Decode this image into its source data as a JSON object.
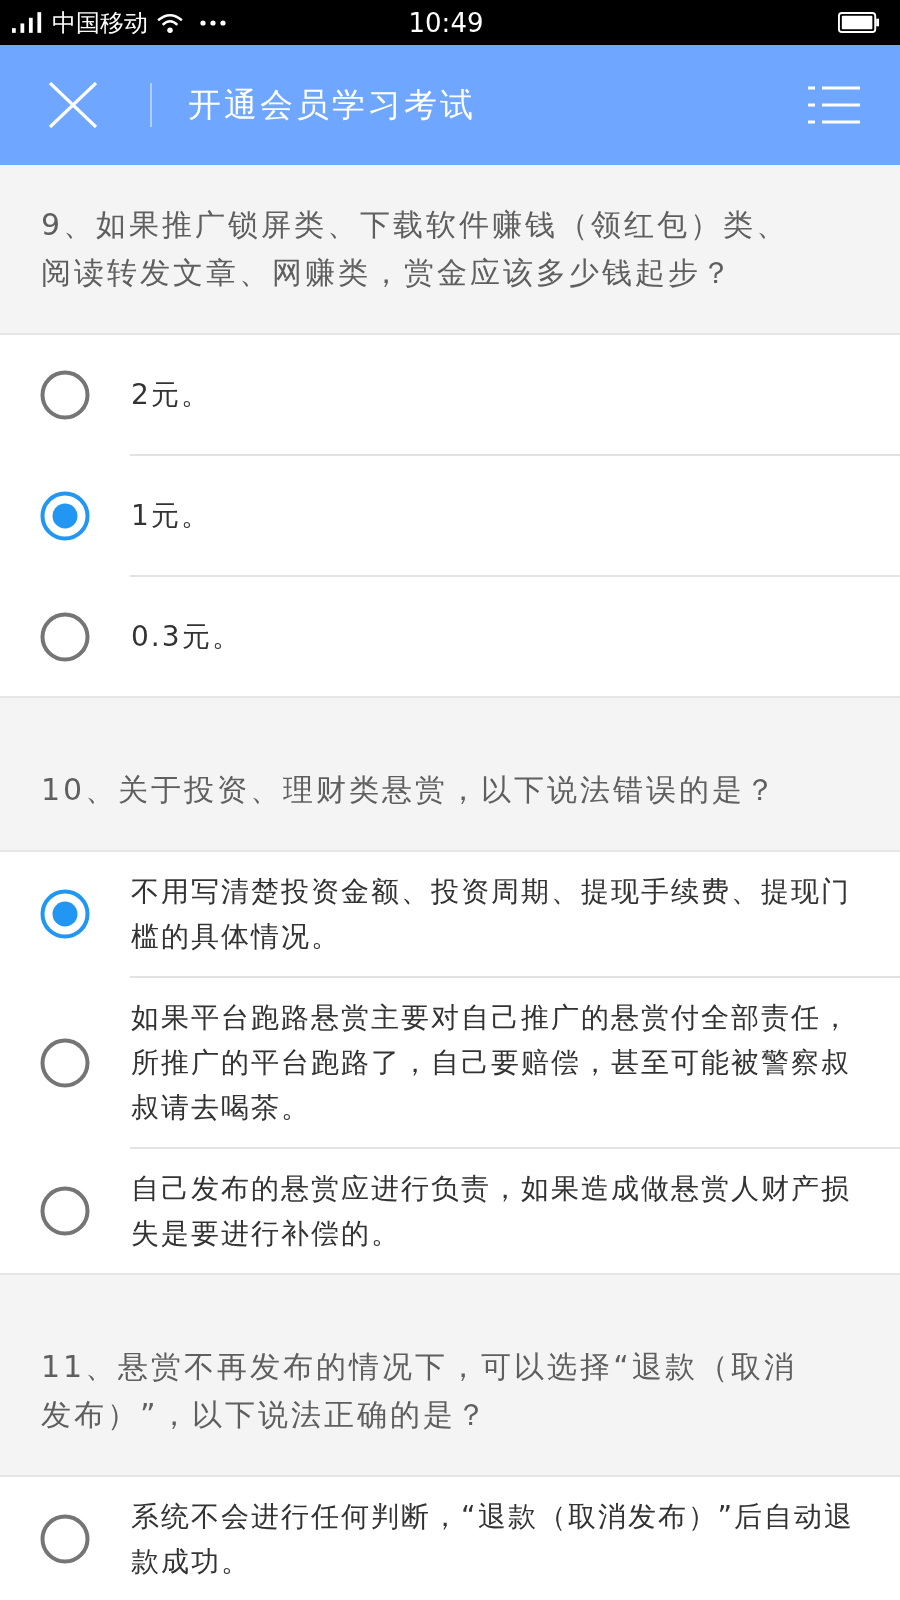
{
  "status_bar": {
    "carrier": "中国移动",
    "time": "10:49"
  },
  "header": {
    "title": "开通会员学习考试"
  },
  "questions": [
    {
      "text": "9、如果推广锁屏类、下载软件赚钱（领红包）类、阅读转发文章、网赚类，赏金应该多少钱起步？",
      "options": [
        {
          "text": "2元。",
          "selected": false
        },
        {
          "text": "1元。",
          "selected": true
        },
        {
          "text": "0.3元。",
          "selected": false
        }
      ]
    },
    {
      "text": "10、关于投资、理财类悬赏，以下说法错误的是？",
      "options": [
        {
          "text": "不用写清楚投资金额、投资周期、提现手续费、提现门槛的具体情况。",
          "selected": true
        },
        {
          "text": "如果平台跑路悬赏主要对自己推广的悬赏付全部责任，所推广的平台跑路了，自己要赔偿，甚至可能被警察叔叔请去喝茶。",
          "selected": false
        },
        {
          "text": "自己发布的悬赏应进行负责，如果造成做悬赏人财产损失是要进行补偿的。",
          "selected": false
        }
      ]
    },
    {
      "text": "11、悬赏不再发布的情况下，可以选择“退款（取消发布）”，以下说法正确的是？",
      "options": [
        {
          "text": "系统不会进行任何判断，“退款（取消发布）”后自动退款成功。",
          "selected": false
        }
      ]
    }
  ]
}
